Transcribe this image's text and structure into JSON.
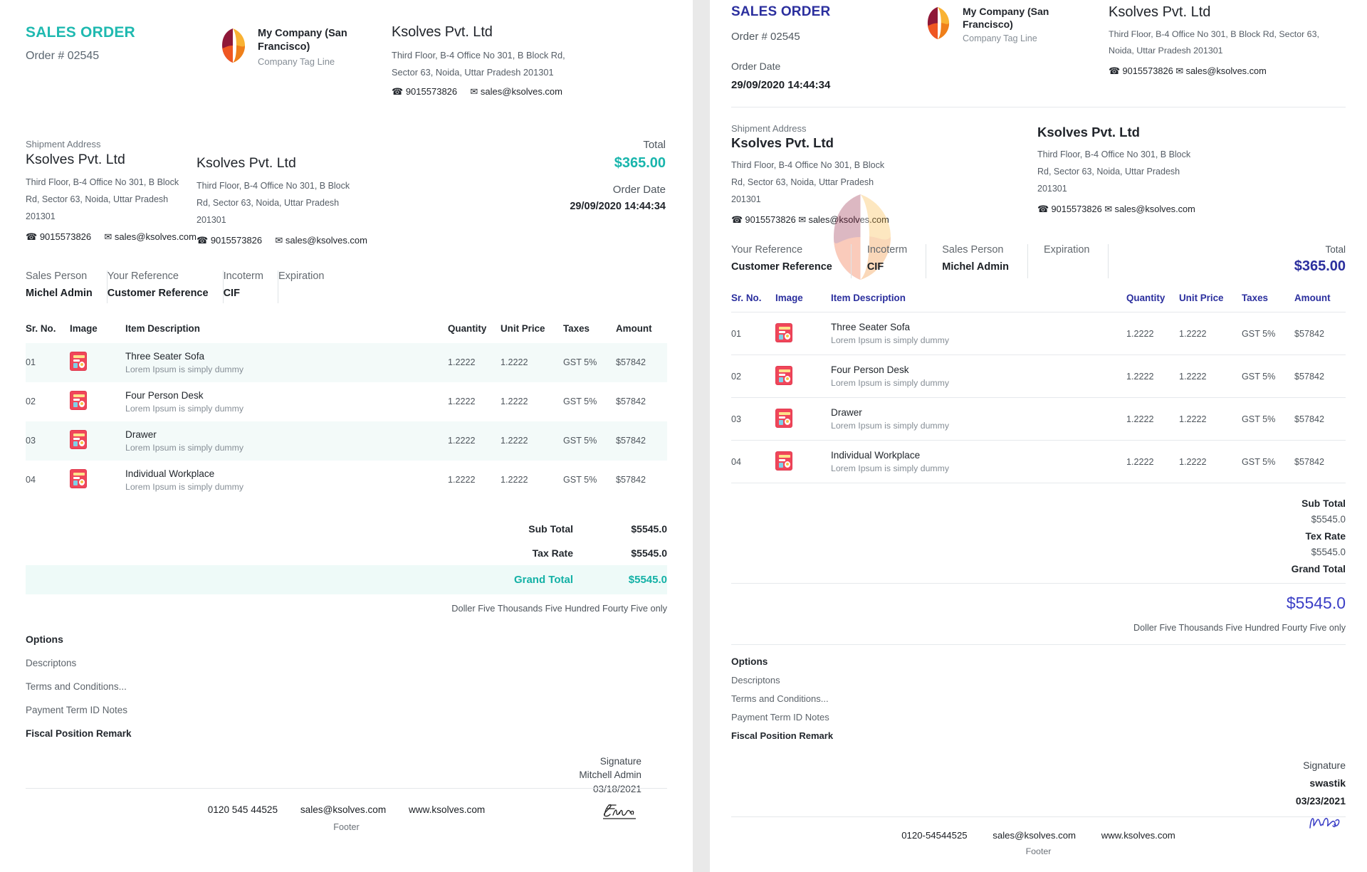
{
  "left": {
    "doc_title": "SALES ORDER",
    "order_number_label": "Order # 02545",
    "company": {
      "name": "My Company (San Francisco)",
      "tagline": "Company Tag Line"
    },
    "customer": {
      "name": "Ksolves Pvt. Ltd",
      "address": "Third Floor, B-4 Office No 301, B Block Rd, Sector 63, Noida, Uttar Pradesh 201301",
      "phone": "9015573826",
      "email": "sales@ksolves.com"
    },
    "shipment": {
      "label": "Shipment Address",
      "name": "Ksolves Pvt. Ltd",
      "address": "Third Floor, B-4 Office No 301, B Block Rd, Sector 63, Noida, Uttar Pradesh 201301",
      "phone": "9015573826",
      "email": "sales@ksolves.com"
    },
    "invoice_addr": {
      "name": "Ksolves Pvt. Ltd",
      "address": "Third Floor, B-4 Office No 301, B Block Rd, Sector 63, Noida, Uttar Pradesh 201301",
      "phone": "9015573826",
      "email": "sales@ksolves.com"
    },
    "total": {
      "label": "Total",
      "value": "$365.00"
    },
    "order_date": {
      "label": "Order Date",
      "value": "29/09/2020 14:44:34"
    },
    "meta": [
      {
        "key": "Sales Person",
        "value": "Michel Admin"
      },
      {
        "key": "Your Reference",
        "value": "Customer Reference"
      },
      {
        "key": "Incoterm",
        "value": "CIF"
      },
      {
        "key": "Expiration",
        "value": ""
      }
    ],
    "table": {
      "headers": [
        "Sr. No.",
        "Image",
        "Item Description",
        "Quantity",
        "Unit Price",
        "Taxes",
        "Amount"
      ],
      "rows": [
        {
          "sr": "01",
          "name": "Three Seater Sofa",
          "desc": "Lorem Ipsum is simply dummy",
          "qty": "1.2222",
          "unit_price": "1.2222",
          "taxes": "GST 5%",
          "amount": "$57842"
        },
        {
          "sr": "02",
          "name": "Four Person Desk",
          "desc": "Lorem Ipsum is simply dummy",
          "qty": "1.2222",
          "unit_price": "1.2222",
          "taxes": "GST 5%",
          "amount": "$57842"
        },
        {
          "sr": "03",
          "name": "Drawer",
          "desc": "Lorem Ipsum is simply dummy",
          "qty": "1.2222",
          "unit_price": "1.2222",
          "taxes": "GST 5%",
          "amount": "$57842"
        },
        {
          "sr": "04",
          "name": "Individual Workplace",
          "desc": "Lorem Ipsum is simply dummy",
          "qty": "1.2222",
          "unit_price": "1.2222",
          "taxes": "GST 5%",
          "amount": "$57842"
        }
      ]
    },
    "totals": [
      {
        "key": "Sub Total",
        "value": "$5545.0"
      },
      {
        "key": "Tax Rate",
        "value": "$5545.0"
      },
      {
        "key": "Grand Total",
        "value": "$5545.0"
      }
    ],
    "amount_in_words": "Doller Five Thousands Five Hundred Fourty Five only",
    "options": {
      "title": "Options",
      "items": [
        "Descriptons",
        "Terms and Conditions...",
        "Payment Term ID Notes",
        "Fiscal Position Remark"
      ]
    },
    "signature": {
      "label": "Signature",
      "name": "Mitchell Admin",
      "date": "03/18/2021"
    },
    "footer": {
      "phone": "0120 545 44525",
      "email": "sales@ksolves.com",
      "website": "www.ksolves.com",
      "note": "Footer"
    }
  },
  "right": {
    "doc_title": "SALES ORDER",
    "order_number_label": "Order # 02545",
    "order_date": {
      "label": "Order Date",
      "value": "29/09/2020 14:44:34"
    },
    "company": {
      "name": "My Company (San Francisco)",
      "tagline": "Company Tag Line"
    },
    "customer": {
      "name": "Ksolves Pvt. Ltd",
      "address": "Third Floor, B-4 Office No 301, B Block Rd, Sector 63, Noida, Uttar Pradesh 201301",
      "phone": "9015573826",
      "email": "sales@ksolves.com"
    },
    "shipment": {
      "label": "Shipment Address",
      "name": "Ksolves Pvt. Ltd",
      "address": "Third Floor, B-4 Office No 301, B Block Rd, Sector 63, Noida, Uttar Pradesh 201301",
      "phone": "9015573826",
      "email": "sales@ksolves.com"
    },
    "invoice_addr": {
      "name": "Ksolves Pvt. Ltd",
      "address": "Third Floor, B-4 Office No 301, B Block Rd, Sector 63, Noida, Uttar Pradesh 201301",
      "phone": "9015573826",
      "email": "sales@ksolves.com"
    },
    "total": {
      "label": "Total",
      "value": "$365.00"
    },
    "meta": [
      {
        "key": "Your Reference",
        "value": "Customer Reference"
      },
      {
        "key": "Incoterm",
        "value": "CIF"
      },
      {
        "key": "Sales Person",
        "value": "Michel Admin"
      },
      {
        "key": "Expiration",
        "value": ""
      }
    ],
    "table": {
      "headers": [
        "Sr. No.",
        "Image",
        "Item Description",
        "Quantity",
        "Unit Price",
        "Taxes",
        "Amount"
      ],
      "rows": [
        {
          "sr": "01",
          "name": "Three Seater Sofa",
          "desc": "Lorem Ipsum is simply dummy",
          "qty": "1.2222",
          "unit_price": "1.2222",
          "taxes": "GST 5%",
          "amount": "$57842"
        },
        {
          "sr": "02",
          "name": "Four Person Desk",
          "desc": "Lorem Ipsum is simply dummy",
          "qty": "1.2222",
          "unit_price": "1.2222",
          "taxes": "GST 5%",
          "amount": "$57842"
        },
        {
          "sr": "03",
          "name": "Drawer",
          "desc": "Lorem Ipsum is simply dummy",
          "qty": "1.2222",
          "unit_price": "1.2222",
          "taxes": "GST 5%",
          "amount": "$57842"
        },
        {
          "sr": "04",
          "name": "Individual Workplace",
          "desc": "Lorem Ipsum is simply dummy",
          "qty": "1.2222",
          "unit_price": "1.2222",
          "taxes": "GST 5%",
          "amount": "$57842"
        }
      ]
    },
    "totals": [
      {
        "key": "Sub Total",
        "value": "$5545.0"
      },
      {
        "key": "Tex Rate",
        "value": "$5545.0"
      }
    ],
    "grand_total": {
      "label": "Grand Total",
      "value": "$5545.0"
    },
    "amount_in_words": "Doller Five Thousands Five Hundred Fourty Five only",
    "options": {
      "title": "Options",
      "items": [
        "Descriptons",
        "Terms and Conditions...",
        "Payment Term ID Notes",
        "Fiscal Position Remark"
      ]
    },
    "signature": {
      "label": "Signature",
      "name": "swastik",
      "date": "03/23/2021"
    },
    "footer": {
      "phone": "0120-54544525",
      "email": "sales@ksolves.com",
      "website": "www.ksolves.com",
      "note": "Footer"
    }
  },
  "colors": {
    "left_accent": "#19b5ac",
    "right_accent": "#2b2f9e",
    "logo_dark_red": "#8f1838",
    "logo_orange": "#ef5622",
    "logo_yellow": "#f9b233",
    "thumb_red": "#f0465a"
  }
}
